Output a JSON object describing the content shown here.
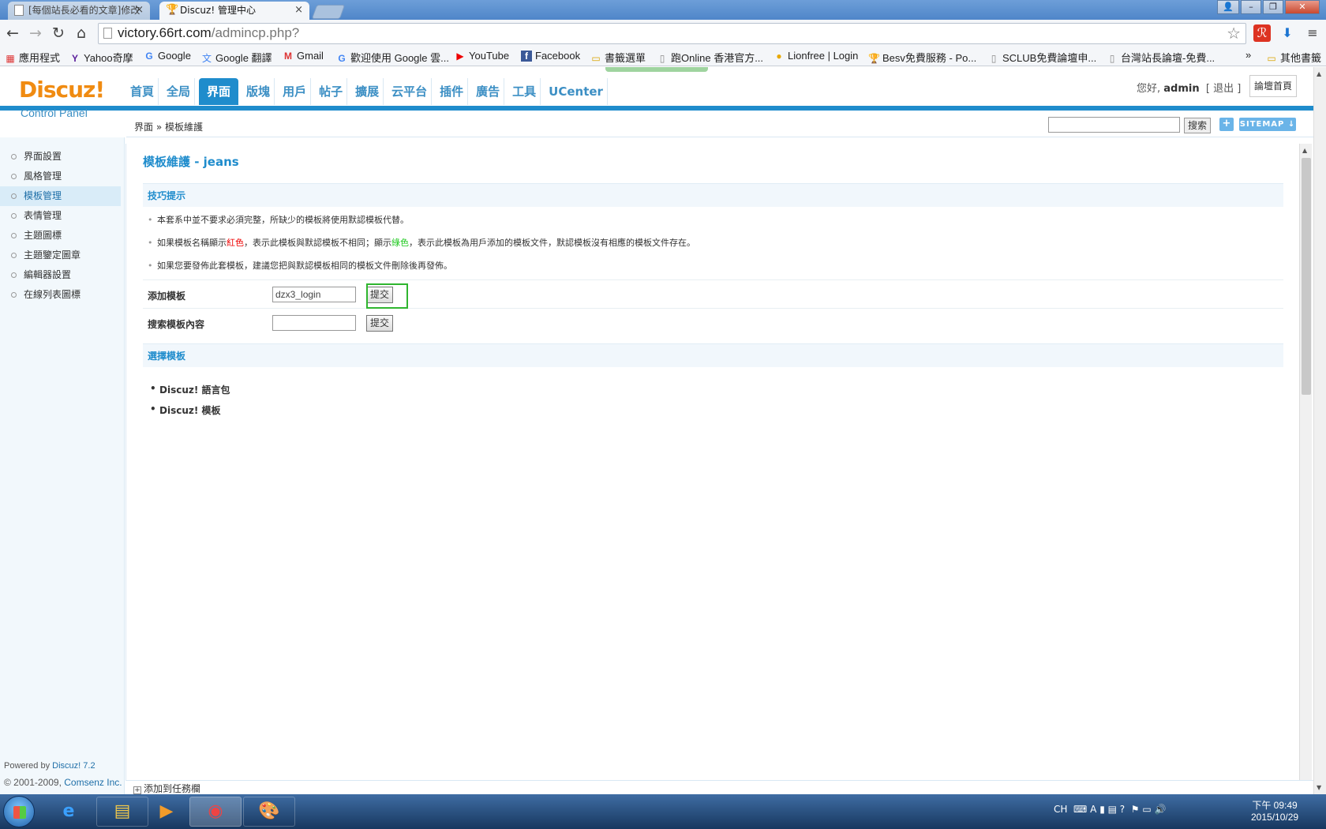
{
  "browser": {
    "tabs": [
      {
        "title": "[每個站長必看的文章]修改"
      },
      {
        "title": "Discuz! 管理中心"
      }
    ],
    "url_host": "victory.66rt.com",
    "url_path": "/admincp.php?",
    "bookmarks": [
      {
        "label": "應用程式",
        "icon": "apps-grid-icon"
      },
      {
        "label": "Yahoo奇摩",
        "icon": "yahoo-icon"
      },
      {
        "label": "Google",
        "icon": "google-icon"
      },
      {
        "label": "Google 翻譯",
        "icon": "google-translate-icon"
      },
      {
        "label": "Gmail",
        "icon": "gmail-icon"
      },
      {
        "label": "歡迎使用 Google 雲...",
        "icon": "google-icon"
      },
      {
        "label": "YouTube",
        "icon": "youtube-icon"
      },
      {
        "label": "Facebook",
        "icon": "facebook-icon"
      },
      {
        "label": "書籤選單",
        "icon": "folder-icon"
      },
      {
        "label": "跑Online 香港官方...",
        "icon": "page-icon"
      },
      {
        "label": "Lionfree | Login",
        "icon": "lionfree-icon"
      },
      {
        "label": "Besv免費服務 - Po...",
        "icon": "trophy-icon"
      },
      {
        "label": "SCLUB免費論壇申...",
        "icon": "page-icon"
      },
      {
        "label": "台灣站長論壇-免費...",
        "icon": "page-icon"
      }
    ],
    "bookmarks_more": "»",
    "other_bookmarks": "其他書籤"
  },
  "header": {
    "logo": "Discuz!",
    "logo_sub": "Control Panel",
    "nav": [
      "首頁",
      "全局",
      "界面",
      "版塊",
      "用戶",
      "帖子",
      "擴展",
      "云平台",
      "插件",
      "廣告",
      "工具",
      "UCenter"
    ],
    "active_nav": "界面",
    "greeting": "您好,",
    "username": "admin",
    "logout": "[ 退出 ]",
    "forum_home": "論壇首頁"
  },
  "crumb": {
    "path": "界面 » 模板維護",
    "search_button": "搜索",
    "plus": "+",
    "sitemap": "SITEMAP ↓"
  },
  "sidebar": {
    "items": [
      "界面設置",
      "風格管理",
      "模板管理",
      "表情管理",
      "主題圖標",
      "主題鑒定圖章",
      "編輯器設置",
      "在線列表圖標"
    ],
    "active": "模板管理",
    "powered_prefix": "Powered by ",
    "powered_link": "Discuz! 7.2",
    "copyright_prefix": "© 2001-2009, ",
    "copyright_link": "Comsenz Inc."
  },
  "main": {
    "title": "模板維護 - jeans",
    "tips_heading": "技巧提示",
    "tip1": "本套系中並不要求必須完整，所缺少的模板將使用默認模板代替。",
    "tip2_a": "如果模板名稱顯示",
    "tip2_red": "紅色",
    "tip2_b": "，表示此模板與默認模板不相同；顯示",
    "tip2_green": "綠色",
    "tip2_c": "，表示此模板為用戶添加的模板文件，默認模板沒有相應的模板文件存在。",
    "tip3": "如果您要發佈此套模板，建議您把與默認模板相同的模板文件刪除後再發佈。",
    "add_template_label": "添加模板",
    "add_template_value": "dzx3_login",
    "search_content_label": "搜索模板內容",
    "search_content_value": "",
    "submit": "提交",
    "choose_heading": "選擇模板",
    "templates": [
      "Discuz! 語言包",
      "Discuz! 模板"
    ],
    "add_to_taskbar": "添加到任務欄"
  },
  "os": {
    "clock_time": "下午 09:49",
    "clock_date": "2015/10/29",
    "tray_lang": "CH"
  }
}
